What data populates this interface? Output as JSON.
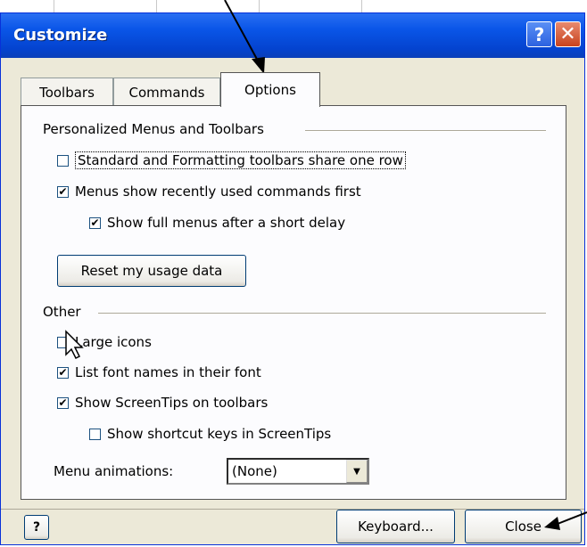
{
  "window": {
    "title": "Customize"
  },
  "tabs": [
    {
      "label": "Toolbars"
    },
    {
      "label": "Commands"
    },
    {
      "label": "Options"
    }
  ],
  "personalized": {
    "heading": "Personalized Menus and Toolbars",
    "options": [
      {
        "label": "Standard and Formatting toolbars share one row",
        "checked": false
      },
      {
        "label": "Menus show recently used commands first",
        "checked": true
      },
      {
        "label": "Show full menus after a short delay",
        "checked": true
      }
    ],
    "reset_label": "Reset my usage data"
  },
  "other": {
    "heading": "Other",
    "options": [
      {
        "label": "Large icons",
        "checked": false
      },
      {
        "label": "List font names in their font",
        "checked": true
      },
      {
        "label": "Show ScreenTips on toolbars",
        "checked": true
      },
      {
        "label": "Show shortcut keys in ScreenTips",
        "checked": false
      }
    ],
    "animations_label": "Menu animations:",
    "animations_value": "(None)"
  },
  "footer": {
    "keyboard_label": "Keyboard...",
    "close_label": "Close"
  },
  "colors": {
    "titlebar": "#0a56e8",
    "dialog_bg": "#ece9d8",
    "panel_bg": "#fcfcfe"
  },
  "icons": [
    "help-icon",
    "close-icon",
    "dropdown-arrow-icon",
    "help-button-icon",
    "pointer-cursor-icon"
  ]
}
